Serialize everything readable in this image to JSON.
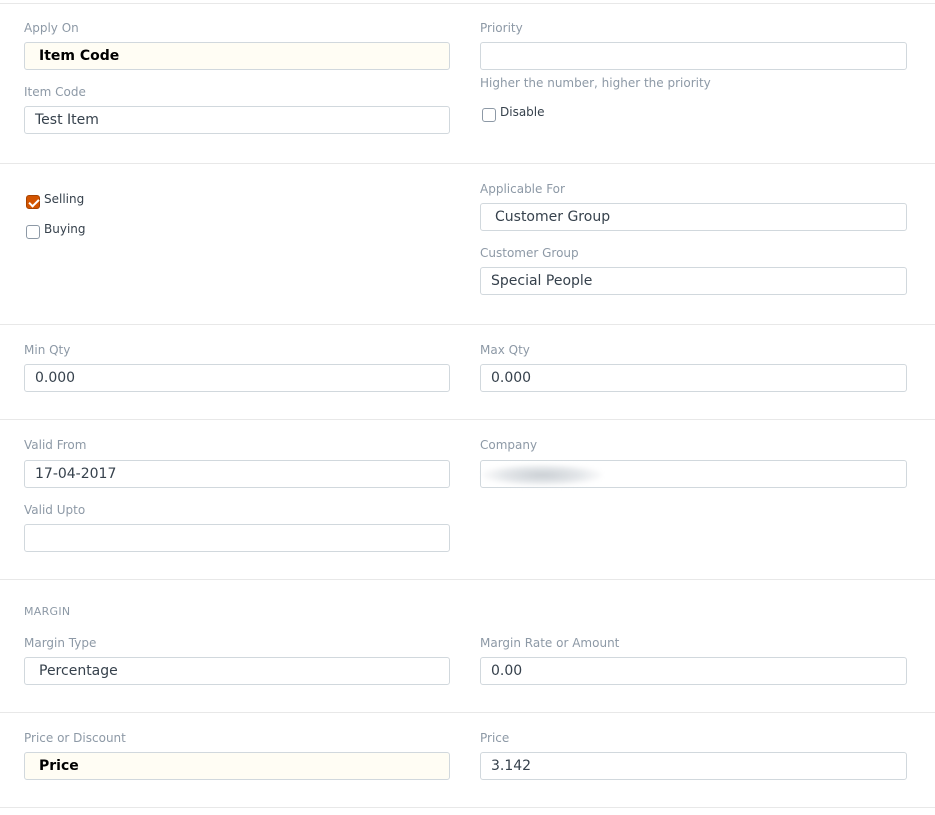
{
  "apply_on": {
    "label": "Apply On",
    "value": "Item Code"
  },
  "priority": {
    "label": "Priority",
    "value": "",
    "help": "Higher the number, higher the priority"
  },
  "item_code": {
    "label": "Item Code",
    "value": "Test Item"
  },
  "disable": {
    "label": "Disable",
    "checked": false
  },
  "selling": {
    "label": "Selling",
    "checked": true
  },
  "buying": {
    "label": "Buying",
    "checked": false
  },
  "applicable_for": {
    "label": "Applicable For",
    "value": "Customer Group"
  },
  "customer_group": {
    "label": "Customer Group",
    "value": "Special People"
  },
  "min_qty": {
    "label": "Min Qty",
    "value": "0.000"
  },
  "max_qty": {
    "label": "Max Qty",
    "value": "0.000"
  },
  "valid_from": {
    "label": "Valid From",
    "value": "17-04-2017"
  },
  "company": {
    "label": "Company",
    "value": ""
  },
  "valid_upto": {
    "label": "Valid Upto",
    "value": ""
  },
  "margin_section": {
    "title": "MARGIN"
  },
  "margin_type": {
    "label": "Margin Type",
    "value": "Percentage"
  },
  "margin_rate": {
    "label": "Margin Rate or Amount",
    "value": "0.00"
  },
  "price_or_discount": {
    "label": "Price or Discount",
    "value": "Price"
  },
  "price": {
    "label": "Price",
    "value": "3.142"
  },
  "colors": {
    "accent": "#d35400",
    "label": "#8d99a6",
    "border": "#d1d8dd",
    "highlight_bg": "#fffdf4"
  }
}
